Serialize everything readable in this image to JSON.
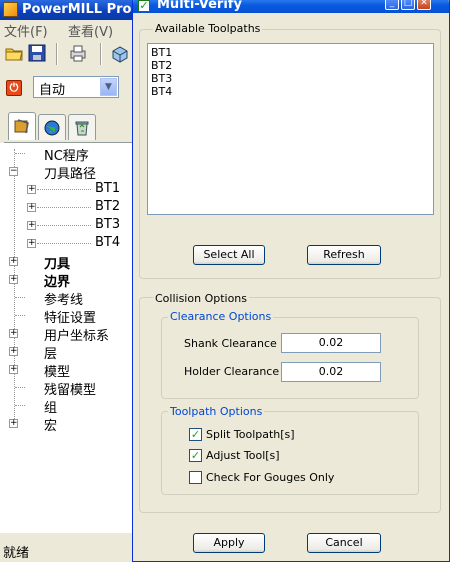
{
  "app": {
    "title": "PowerMILL Pro",
    "menu": [
      "文件(F)",
      "查看(V)"
    ],
    "combo_value": "自动",
    "tree": {
      "root_items": [
        {
          "label": "NC程序",
          "expandable": false,
          "bold": false
        },
        {
          "label": "刀具路径",
          "expandable": true,
          "expanded": true,
          "bold": false,
          "children": [
            "BT1",
            "BT2",
            "BT3",
            "BT4"
          ]
        },
        {
          "label": "刀具",
          "expandable": true,
          "bold": true
        },
        {
          "label": "边界",
          "expandable": true,
          "bold": true
        },
        {
          "label": "参考线",
          "expandable": false,
          "bold": false
        },
        {
          "label": "特征设置",
          "expandable": false,
          "bold": false
        },
        {
          "label": "用户坐标系",
          "expandable": true,
          "bold": false
        },
        {
          "label": "层",
          "expandable": true,
          "bold": false
        },
        {
          "label": "模型",
          "expandable": true,
          "bold": false
        },
        {
          "label": "残留模型",
          "expandable": false,
          "bold": false
        },
        {
          "label": "组",
          "expandable": false,
          "bold": false
        },
        {
          "label": "宏",
          "expandable": true,
          "bold": false
        }
      ]
    },
    "status": "就绪"
  },
  "dialog": {
    "title": "Multi-Verify",
    "available_label": "Available Toolpaths",
    "toolpaths": [
      "BT1",
      "BT2",
      "BT3",
      "BT4"
    ],
    "select_all": "Select All",
    "refresh": "Refresh",
    "collision_label": "Collision Options",
    "clearance_label": "Clearance Options",
    "shank_label": "Shank Clearance",
    "shank_value": "0.02",
    "holder_label": "Holder Clearance",
    "holder_value": "0.02",
    "toolpath_options_label": "Toolpath Options",
    "options": [
      {
        "label": "Split Toolpath[s]",
        "checked": true
      },
      {
        "label": "Adjust Tool[s]",
        "checked": true
      },
      {
        "label": "Check For Gouges Only",
        "checked": false
      }
    ],
    "apply": "Apply",
    "cancel": "Cancel"
  },
  "colors": {
    "titlebar_blue": "#0a5ae0",
    "group_label_blue": "#0046d5",
    "check_green": "#21a121"
  }
}
